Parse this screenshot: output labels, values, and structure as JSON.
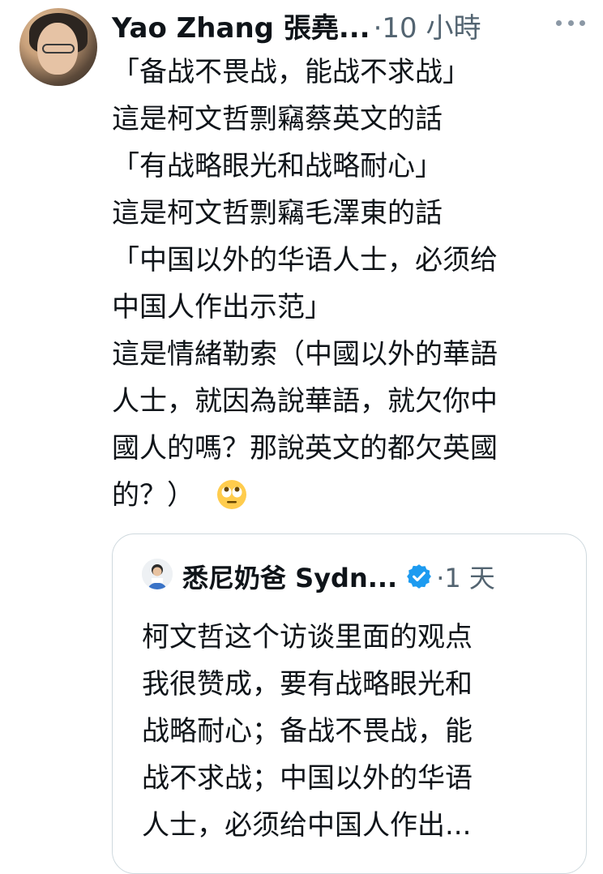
{
  "tweet": {
    "author": "Yao Zhang 張堯...",
    "meta": "·10 小時",
    "more_icon": "more-horizontal-icon",
    "lines": [
      "「备战不畏战，能战不求战」",
      "這是柯文哲剽竊蔡英文的話",
      "「有战略眼光和战略耐心」",
      "這是柯文哲剽竊毛澤東的話",
      "「中国以外的华语人士，必须给",
      "中国人作出示范」",
      "這是情緒勒索（中國以外的華語",
      "人士，就因為說華語，就欠你中",
      "國人的嗎？那說英文的都欠英國",
      "的？）"
    ],
    "emoji": "face-with-rolling-eyes-icon"
  },
  "quoted": {
    "author": "悉尼奶爸 Sydn...",
    "verified_icon": "verified-badge-icon",
    "meta": "·1 天",
    "lines": [
      "柯文哲这个访谈里面的观点",
      "我很赞成，要有战略眼光和",
      "战略耐心；备战不畏战，能",
      "战不求战；中国以外的华语",
      "人士，必须给中国人作出..."
    ]
  },
  "colors": {
    "text": "#0f1419",
    "secondary": "#536471",
    "border": "#cfd9de",
    "verified": "#1d9bf0"
  }
}
